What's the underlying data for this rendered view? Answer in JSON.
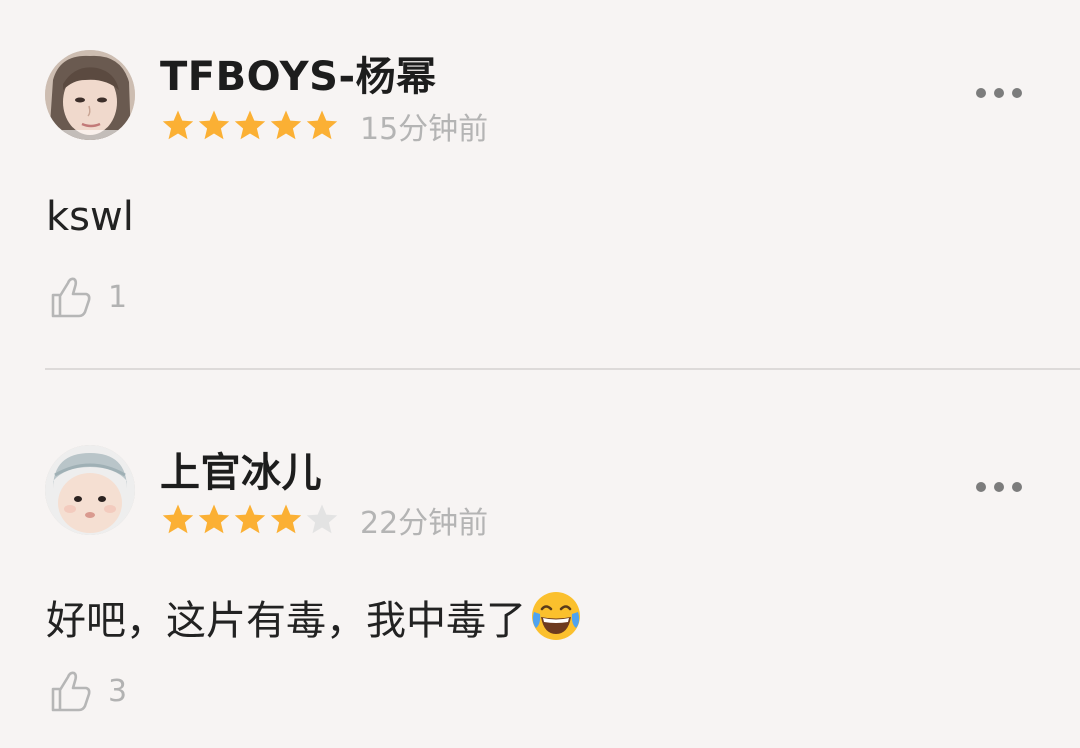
{
  "comments": [
    {
      "username": "TFBOYS-杨幂",
      "rating": 5,
      "time": "15分钟前",
      "text": "kswl",
      "likes": "1",
      "icons": {
        "avatar": "avatar-photo",
        "more": "more-horizontal-icon",
        "like": "thumbs-up-icon"
      }
    },
    {
      "username": "上官冰儿",
      "rating": 4,
      "time": "22分钟前",
      "text": "好吧，这片有毒，我中毒了",
      "emoji": "tears-of-joy-emoji",
      "likes": "3",
      "icons": {
        "avatar": "avatar-photo",
        "more": "more-horizontal-icon",
        "like": "thumbs-up-icon"
      }
    }
  ],
  "colors": {
    "star_on": "#fbb034",
    "star_off": "#e3e3e3",
    "background": "#f7f4f3"
  }
}
